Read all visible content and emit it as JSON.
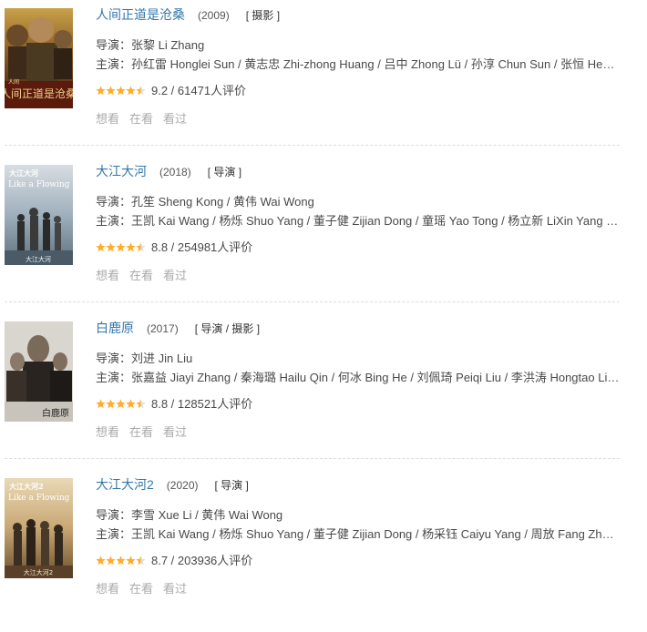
{
  "items": [
    {
      "title": "人间正道是沧桑",
      "year": "(2009)",
      "roles": "[ 摄影 ]",
      "director": "导演：张黎 Li Zhang",
      "cast": "主演：孙红雷 Honglei Sun / 黄志忠 Zhi-zhong Huang / 吕中 Zhong Lü / 孙淳 Chun Sun / 张恒 He…",
      "rating_text": "9.2 / 61471人评价",
      "rating_stars": 4.5,
      "actions": [
        "想看",
        "在看",
        "看过"
      ],
      "poster_caption": "人间正道是沧桑",
      "poster_tag": "人间"
    },
    {
      "title": "大江大河",
      "year": "(2018)",
      "roles": "[ 导演 ]",
      "director": "导演：孔笙 Sheng Kong / 黄伟 Wai Wong",
      "cast": "主演：王凯 Kai Wang / 杨烁 Shuo Yang / 董子健 Zijian Dong / 童瑶 Yao Tong / 杨立新 LiXin Yang …",
      "rating_text": "8.8 / 254981人评价",
      "rating_stars": 4.5,
      "actions": [
        "想看",
        "在看",
        "看过"
      ],
      "poster_caption": "大江大河",
      "poster_tag": "Like a Flowing River"
    },
    {
      "title": "白鹿原",
      "year": "(2017)",
      "roles": "[ 导演 / 摄影 ]",
      "director": "导演：刘进 Jin Liu",
      "cast": "主演：张嘉益 Jiayi Zhang / 秦海璐 Hailu Qin / 何冰 Bing He / 刘佩琦 Peiqi Liu / 李洪涛 Hongtao Li…",
      "rating_text": "8.8 / 128521人评价",
      "rating_stars": 4.5,
      "actions": [
        "想看",
        "在看",
        "看过"
      ],
      "poster_caption": "白鹿原",
      "poster_tag": ""
    },
    {
      "title": "大江大河2",
      "year": "(2020)",
      "roles": "[ 导演 ]",
      "director": "导演：李雪 Xue Li / 黄伟 Wai Wong",
      "cast": "主演：王凯 Kai Wang / 杨烁 Shuo Yang / 董子健 Zijian Dong / 杨采钰 Caiyu Yang / 周放 Fang Zh…",
      "rating_text": "8.7 / 203936人评价",
      "rating_stars": 4.5,
      "actions": [
        "想看",
        "在看",
        "看过"
      ],
      "poster_caption": "大江大河2",
      "poster_tag": "Like a Flowing River"
    }
  ],
  "colors": {
    "title_link": "#3377aa",
    "star": "#ffac2d",
    "star_empty": "#e0e0e0",
    "action": "#aaaaaa",
    "divider": "#dddddd"
  }
}
